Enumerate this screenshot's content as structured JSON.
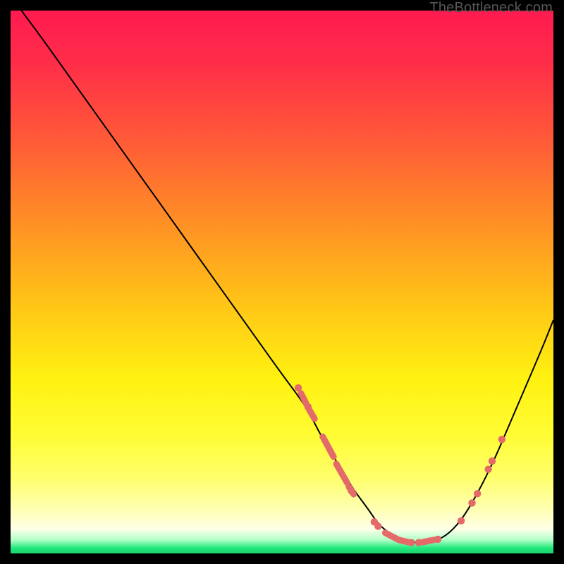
{
  "watermark": "TheBottleneck.com",
  "chart_data": {
    "type": "line",
    "title": "",
    "xlabel": "",
    "ylabel": "",
    "xlim": [
      0,
      100
    ],
    "ylim": [
      0,
      100
    ],
    "background": {
      "type": "vertical-gradient",
      "stops": [
        {
          "offset": 0.0,
          "color": "#ff1a50"
        },
        {
          "offset": 0.1,
          "color": "#ff2e48"
        },
        {
          "offset": 0.25,
          "color": "#ff5e36"
        },
        {
          "offset": 0.4,
          "color": "#ff9324"
        },
        {
          "offset": 0.55,
          "color": "#ffc816"
        },
        {
          "offset": 0.68,
          "color": "#fff211"
        },
        {
          "offset": 0.78,
          "color": "#fffc33"
        },
        {
          "offset": 0.86,
          "color": "#ffff6b"
        },
        {
          "offset": 0.92,
          "color": "#ffffb4"
        },
        {
          "offset": 0.955,
          "color": "#ffffe8"
        },
        {
          "offset": 0.975,
          "color": "#b2ffc9"
        },
        {
          "offset": 0.99,
          "color": "#22e87a"
        },
        {
          "offset": 1.0,
          "color": "#18d46e"
        }
      ]
    },
    "series": [
      {
        "name": "curve",
        "color": "#000000",
        "x": [
          2,
          5,
          10,
          15,
          20,
          25,
          30,
          35,
          40,
          45,
          50,
          53,
          55,
          57,
          60,
          63,
          66,
          68,
          71,
          74,
          77,
          80,
          83,
          86,
          89,
          92,
          95,
          98,
          100
        ],
        "y": [
          100,
          96,
          89,
          82,
          75,
          68,
          61,
          54,
          47,
          40,
          33,
          29,
          26,
          22,
          17,
          12,
          8,
          5,
          3,
          2,
          2,
          3,
          6,
          11,
          17,
          24,
          31,
          38,
          43
        ]
      }
    ],
    "markers": {
      "color": "#e46a6a",
      "hatches": [
        {
          "x0": 53.5,
          "y0": 29.5,
          "x1": 54.5,
          "y1": 27.5
        },
        {
          "x0": 55.0,
          "y0": 26.5,
          "x1": 56.0,
          "y1": 24.8
        },
        {
          "x0": 57.5,
          "y0": 21.5,
          "x1": 59.5,
          "y1": 17.8
        },
        {
          "x0": 60.0,
          "y0": 16.5,
          "x1": 62.0,
          "y1": 13.0
        },
        {
          "x0": 62.3,
          "y0": 12.3,
          "x1": 63.2,
          "y1": 10.9
        },
        {
          "x0": 69.0,
          "y0": 3.8,
          "x1": 71.3,
          "y1": 2.6
        },
        {
          "x0": 71.5,
          "y0": 2.5,
          "x1": 73.2,
          "y1": 2.1
        },
        {
          "x0": 76.0,
          "y0": 2.1,
          "x1": 78.0,
          "y1": 2.5
        }
      ],
      "dots": [
        {
          "x": 53.0,
          "y": 30.5
        },
        {
          "x": 54.8,
          "y": 27.0
        },
        {
          "x": 62.8,
          "y": 11.5
        },
        {
          "x": 67.0,
          "y": 5.8
        },
        {
          "x": 67.7,
          "y": 5.0
        },
        {
          "x": 73.8,
          "y": 2.0
        },
        {
          "x": 75.2,
          "y": 2.0
        },
        {
          "x": 78.7,
          "y": 2.6
        },
        {
          "x": 83.0,
          "y": 6.0
        },
        {
          "x": 85.0,
          "y": 9.3
        },
        {
          "x": 86.0,
          "y": 11.0
        },
        {
          "x": 88.0,
          "y": 15.5
        },
        {
          "x": 88.7,
          "y": 17.0
        },
        {
          "x": 90.5,
          "y": 21.0
        }
      ]
    }
  }
}
